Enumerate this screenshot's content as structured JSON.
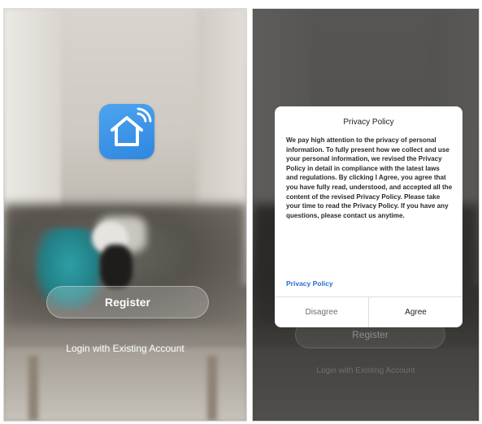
{
  "left_screen": {
    "register_label": "Register",
    "login_label": "Login with Existing Account",
    "app_icon": "smart-home-icon"
  },
  "right_screen": {
    "register_label": "Register",
    "login_label": "Login with Existing Account",
    "dialog": {
      "title": "Privacy Policy",
      "body": "We pay high attention to the privacy of personal information. To fully present how we collect and use your personal information, we revised the Privacy Policy in detail in compliance with the latest laws and regulations. By clicking I Agree, you agree that you have fully read, understood, and accepted all the content of the revised Privacy Policy. Please take your time to read the Privacy Policy. If you have any questions, please contact us anytime.",
      "link_label": "Privacy Policy",
      "disagree_label": "Disagree",
      "agree_label": "Agree"
    }
  },
  "colors": {
    "accent_blue": "#2f86e0",
    "link_blue": "#2a6cd0",
    "teal": "#2e9fa5"
  }
}
